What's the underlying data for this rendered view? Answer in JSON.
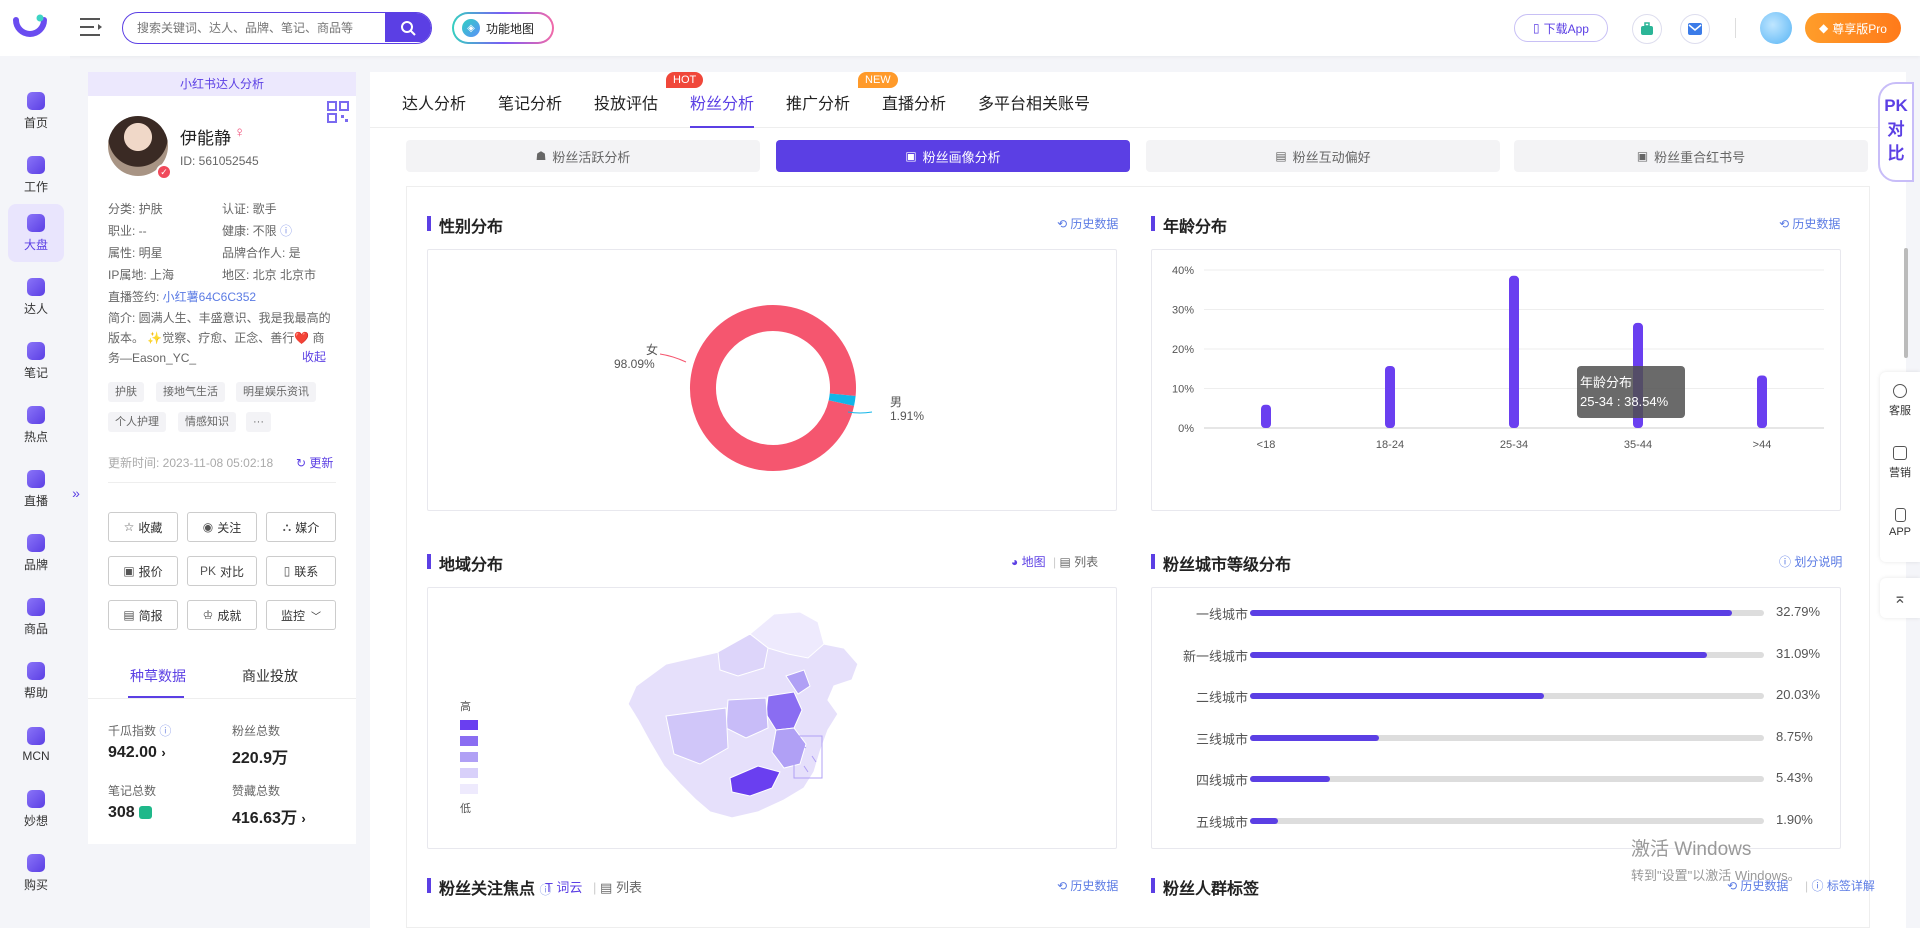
{
  "header": {
    "search_placeholder": "搜索关键词、达人、品牌、笔记、商品等",
    "func_map_label": "功能地图",
    "download_app_label": "下载App",
    "pro_label": "尊享版Pro"
  },
  "nav": [
    {
      "label": "首页",
      "icon": "home-icon"
    },
    {
      "label": "工作",
      "icon": "workbench-icon"
    },
    {
      "label": "大盘",
      "icon": "pie-icon",
      "active": true
    },
    {
      "label": "达人",
      "icon": "person-icon"
    },
    {
      "label": "笔记",
      "icon": "note-icon"
    },
    {
      "label": "热点",
      "icon": "flame-icon"
    },
    {
      "label": "直播",
      "icon": "live-icon"
    },
    {
      "label": "品牌",
      "icon": "brand-icon"
    },
    {
      "label": "商品",
      "icon": "goods-icon"
    },
    {
      "label": "帮助",
      "icon": "help-icon"
    },
    {
      "label": "MCN",
      "icon": "mcn-icon"
    },
    {
      "label": "妙想",
      "icon": "idea-icon"
    },
    {
      "label": "购买",
      "icon": "cart-icon"
    }
  ],
  "profile": {
    "banner": "小红书达人分析",
    "name": "伊能静",
    "gender_symbol": "♀",
    "id_label": "ID:  561052545",
    "category": "分类: 护肤",
    "certification": "认证: 歌手",
    "occupation": "职业: --",
    "health": "健康: 不限",
    "attribute": "属性: 明星",
    "brand_partner": "品牌合作人: 是",
    "ip_location": "IP属地: 上海",
    "region": "地区: 北京 北京市",
    "live_contract_label": "直播签约: ",
    "live_contract_value": "小红薯64C6C352",
    "intro_1": "简介: 圆满人生、丰盛意识、我是我最高的",
    "intro_2": "版本。 ✨觉察、疗愈、正念、善行❤️ 商",
    "intro_3": "务—Eason_YC_",
    "collapse_label": "收起",
    "tags": [
      "护肤",
      "接地气生活",
      "明星娱乐资讯",
      "个人护理",
      "情感知识",
      "···"
    ],
    "update_time": "更新时间: 2023-11-08 05:02:18",
    "refresh_label": "更新",
    "actions": [
      {
        "label": "收藏",
        "icon": "star-icon",
        "glyph": "☆"
      },
      {
        "label": "关注",
        "icon": "eye-icon",
        "glyph": "◉"
      },
      {
        "label": "媒介",
        "icon": "media-icon",
        "glyph": "⛬"
      },
      {
        "label": "报价",
        "icon": "price-icon",
        "glyph": "▣"
      },
      {
        "label": "对比",
        "icon": "pk-icon",
        "glyph": "PK"
      },
      {
        "label": "联系",
        "icon": "phone-icon",
        "glyph": "▯"
      },
      {
        "label": "简报",
        "icon": "report-icon",
        "glyph": "▤"
      },
      {
        "label": "成就",
        "icon": "crown-icon",
        "glyph": "♔"
      },
      {
        "label": "监控",
        "icon": "monitor-icon",
        "glyph": ""
      }
    ],
    "tab_seed": "种草数据",
    "tab_commercial": "商业投放",
    "stats": {
      "qiangua_label": "千瓜指数",
      "qiangua_value": "942.00",
      "fans_label": "粉丝总数",
      "fans_value": "220.9万",
      "notes_label": "笔记总数",
      "notes_value": "308",
      "likes_label": "赞藏总数",
      "likes_value": "416.63万"
    }
  },
  "tabs": [
    {
      "label": "达人分析"
    },
    {
      "label": "笔记分析"
    },
    {
      "label": "投放评估"
    },
    {
      "label": "粉丝分析",
      "active": true
    },
    {
      "label": "推广分析"
    },
    {
      "label": "直播分析"
    },
    {
      "label": "多平台相关账号"
    }
  ],
  "badges": {
    "hot": "HOT",
    "new": "NEW"
  },
  "subtabs": [
    {
      "label": "粉丝活跃分析"
    },
    {
      "label": "粉丝画像分析",
      "active": true
    },
    {
      "label": "粉丝互动偏好"
    },
    {
      "label": "粉丝重合红书号"
    }
  ],
  "sections": {
    "gender_title": "性别分布",
    "age_title": "年龄分布",
    "region_title": "地域分布",
    "city_title": "粉丝城市等级分布",
    "focus_title": "粉丝关注焦点",
    "crowd_title": "粉丝人群标签",
    "history_label": "历史数据",
    "map_label": "地图",
    "list_label": "列表",
    "wordcloud_label": "词云",
    "explain_label": "划分说明",
    "tag_detail_label": "标签详解",
    "map_legend_high": "高",
    "map_legend_low": "低"
  },
  "gender_chart": {
    "female_label": "女",
    "female_pct": "98.09%",
    "male_label": "男",
    "male_pct": "1.91%"
  },
  "chart_data": [
    {
      "type": "pie",
      "categories": [
        "女",
        "男"
      ],
      "values": [
        98.09,
        1.91
      ],
      "colors": [
        "#f5566f",
        "#12b5e8"
      ],
      "title": "性别分布"
    },
    {
      "type": "bar",
      "title": "年龄分布",
      "categories": [
        "<18",
        "18-24",
        "25-34",
        "35-44",
        ">44"
      ],
      "values": [
        5.9,
        15.7,
        38.54,
        26.6,
        13.3
      ],
      "ylim": [
        0,
        40
      ],
      "yticks": [
        "0%",
        "10%",
        "20%",
        "30%",
        "40%"
      ],
      "color": "#6a3ff0",
      "tooltip": {
        "title": "年龄分布",
        "text": "25-34 : 38.54%"
      }
    },
    {
      "type": "bar",
      "title": "粉丝城市等级分布",
      "categories": [
        "一线城市",
        "新一线城市",
        "二线城市",
        "三线城市",
        "四线城市",
        "五线城市"
      ],
      "values": [
        32.79,
        31.09,
        20.03,
        8.75,
        5.43,
        1.9
      ],
      "labels": [
        "32.79%",
        "31.09%",
        "20.03%",
        "8.75%",
        "5.43%",
        "1.90%"
      ],
      "color": "#5b3fe4"
    }
  ],
  "right_tools": {
    "pk_1": "PK",
    "pk_2": "对",
    "pk_3": "比",
    "service": "客服",
    "marketing": "营销",
    "app": "APP"
  },
  "watermark": {
    "line1": "激活 Windows",
    "line2": "转到\"设置\"以激活 Windows。"
  }
}
